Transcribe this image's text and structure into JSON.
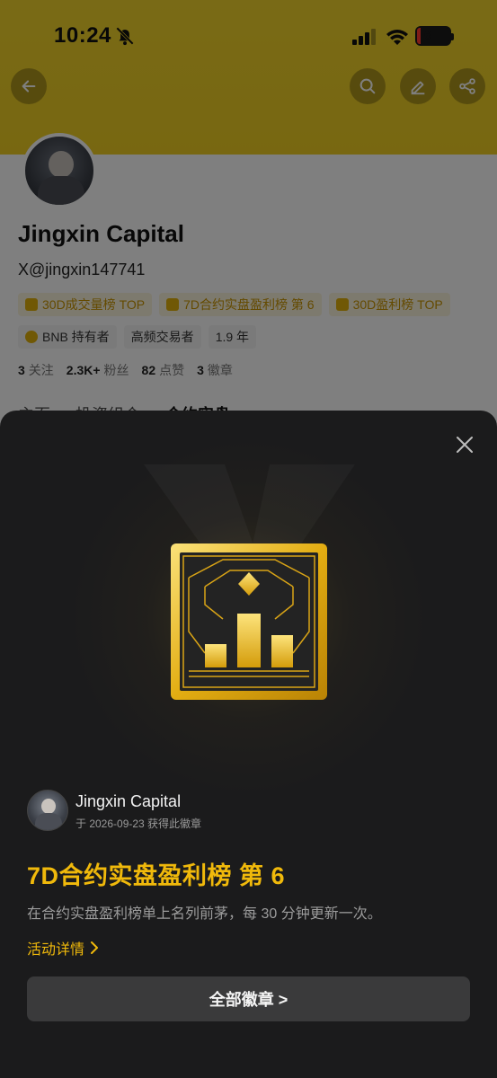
{
  "status_bar": {
    "time": "10:24",
    "battery": "6"
  },
  "profile": {
    "name": "Jingxin Capital",
    "handle": "X@jingxin147741",
    "badges_row1": [
      {
        "label": "30D成交量榜 TOP"
      },
      {
        "label": "7D合约实盘盈利榜 第 6"
      },
      {
        "label": "30D盈利榜 TOP"
      }
    ],
    "badges_row2": [
      {
        "label": "BNB 持有者"
      },
      {
        "label": "高频交易者"
      },
      {
        "label": "1.9 年"
      }
    ],
    "stats": [
      {
        "value": "3",
        "label": "关注"
      },
      {
        "value": "2.3K+",
        "label": "粉丝"
      },
      {
        "value": "82",
        "label": "点赞"
      },
      {
        "value": "3",
        "label": "徽章"
      }
    ],
    "tabs": [
      "主页",
      "投资组合",
      "合约实盘"
    ]
  },
  "modal": {
    "owner_name": "Jingxin Capital",
    "earned_date": "于 2026-09-23 获得此徽章",
    "badge_title": "7D合约实盘盈利榜 第 6",
    "badge_desc": "在合约实盘盈利榜单上名列前茅，每 30 分钟更新一次。",
    "activity_link": "活动详情",
    "all_badges_button": "全部徽章 >"
  },
  "colors": {
    "banner": "#f0cf22",
    "accent_gold": "#f0b90b",
    "sheet_bg": "#1b1b1c",
    "button_bg": "#3a3a3b"
  },
  "icons": {
    "back": "arrow-left-icon",
    "search": "search-icon",
    "edit": "pencil-icon",
    "share": "share-icon",
    "close": "close-icon",
    "medal": "leaderboard-medal-icon"
  }
}
